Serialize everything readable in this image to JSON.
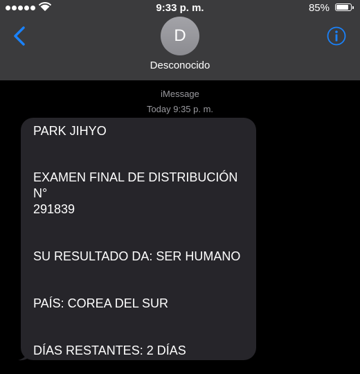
{
  "status_bar": {
    "carrier_signal": "signal-dots",
    "time": "9:33 p. m.",
    "battery_percent": "85%",
    "battery_level": 0.85
  },
  "header": {
    "avatar_initial": "D",
    "contact_name": "Desconocido",
    "accent_color": "#1a82fb"
  },
  "conversation": {
    "service": "iMessage",
    "timestamp": "Today 9:35 p. m.",
    "message": {
      "lines": [
        "PARK JIHYO",
        "EXAMEN FINAL DE DISTRIBUCIÓN N°",
        "291839",
        "SU RESULTADO DA: SER HUMANO",
        "PAÍS: COREA DEL SUR",
        "DÍAS RESTANTES: 2 DÍAS"
      ]
    }
  }
}
